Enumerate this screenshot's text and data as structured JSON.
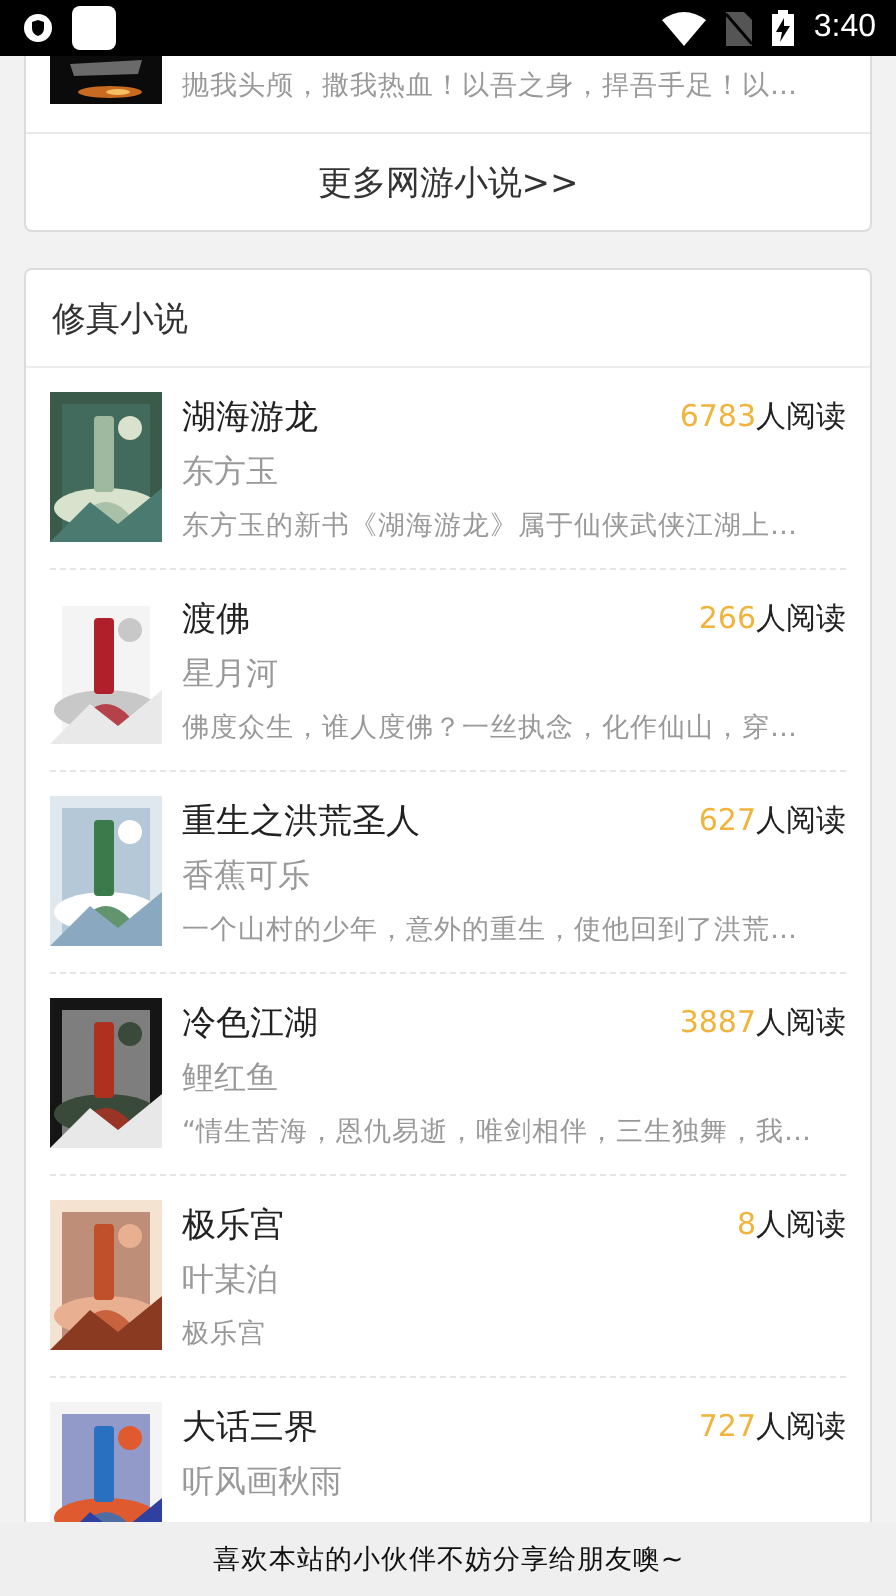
{
  "status_bar": {
    "time": "3:40"
  },
  "previous_section": {
    "last_item": {
      "description": "抛我头颅，撒我热血！以吾之身，捍吾手足！以…"
    },
    "more_link": "更多网游小说>>"
  },
  "section": {
    "title": "修真小说",
    "books": [
      {
        "title": "湖海游龙",
        "author": "东方玉",
        "reads": "6783",
        "reads_suffix": "人阅读",
        "description": "东方玉的新书《湖海游龙》属于仙侠武侠江湖上…"
      },
      {
        "title": "渡佛",
        "author": "星月河",
        "reads": "266",
        "reads_suffix": "人阅读",
        "description": "佛度众生，谁人度佛？一丝执念，化作仙山，穿…"
      },
      {
        "title": "重生之洪荒圣人",
        "author": "香蕉可乐",
        "reads": "627",
        "reads_suffix": "人阅读",
        "description": "一个山村的少年，意外的重生，使他回到了洪荒…"
      },
      {
        "title": "冷色江湖",
        "author": "鲤红鱼",
        "reads": "3887",
        "reads_suffix": "人阅读",
        "description": "“情生苦海，恩仇易逝，唯剑相伴，三生独舞，我…"
      },
      {
        "title": "极乐宫",
        "author": "叶某泊",
        "reads": "8",
        "reads_suffix": "人阅读",
        "description": "极乐宫"
      },
      {
        "title": "大话三界",
        "author": "听风画秋雨",
        "reads": "727",
        "reads_suffix": "人阅读"
      }
    ]
  },
  "share_banner": "喜欢本站的小伙伴不妨分享给朋友噢~"
}
